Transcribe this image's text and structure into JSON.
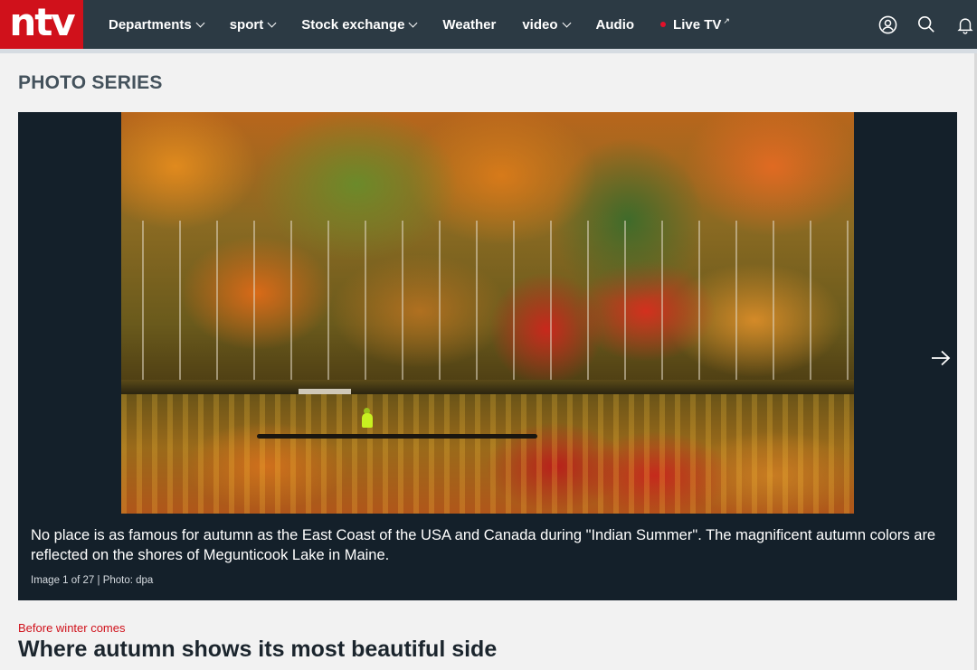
{
  "header": {
    "logo_text": "ntv",
    "brand_color": "#d0111b",
    "bar_color": "#2c3a44",
    "nav": [
      {
        "label": "Departments",
        "dropdown": true
      },
      {
        "label": "sport",
        "dropdown": true
      },
      {
        "label": "Stock exchange",
        "dropdown": true
      },
      {
        "label": "Weather",
        "dropdown": false
      },
      {
        "label": "video",
        "dropdown": true
      },
      {
        "label": "Audio",
        "dropdown": false
      },
      {
        "label": "Live TV",
        "dropdown": false,
        "live_dot": true,
        "external": true
      }
    ],
    "external_mark": "↗",
    "icons": [
      "user-account-icon",
      "search-icon",
      "bell-icon"
    ]
  },
  "section": {
    "title": "PHOTO SERIES"
  },
  "gallery": {
    "caption": "No place is as famous for autumn as the East Coast of the USA and Canada during \"Indian Summer\". The magnificent autumn colors are reflected on the shores of Megunticook Lake in Maine.",
    "credit": "Image 1 of 27 | Photo: dpa",
    "next_icon": "arrow-right-icon"
  },
  "article": {
    "kicker": "Before winter comes",
    "headline": "Where autumn shows its most beautiful side"
  }
}
